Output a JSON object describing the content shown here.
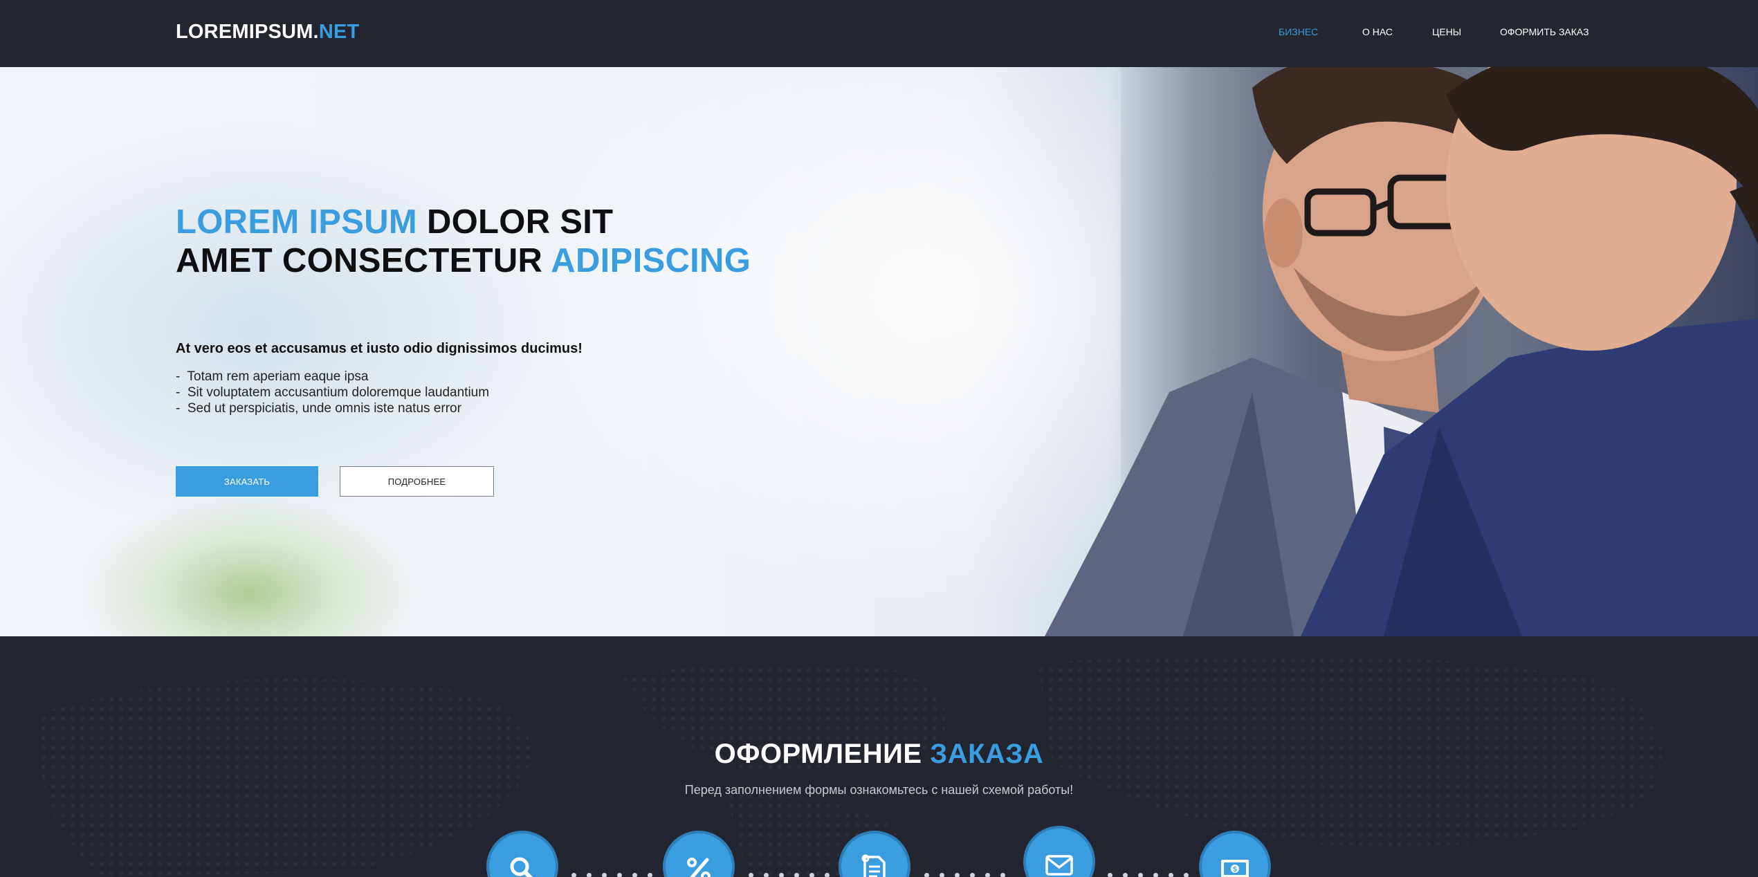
{
  "header": {
    "logo_main": "LOREMIPSUM.",
    "logo_accent": "NET",
    "nav": [
      {
        "label": "БИЗНЕС",
        "active": true
      },
      {
        "label": "О НАС",
        "active": false
      },
      {
        "label": "ЦЕНЫ",
        "active": false
      },
      {
        "label": "ОФОРМИТЬ ЗАКАЗ",
        "active": false
      }
    ]
  },
  "hero": {
    "title": {
      "part1_accent": "LOREM IPSUM",
      "part2": " DOLOR SIT",
      "part3": "AMET CONSECTETUR ",
      "part4_accent": "ADIPISCING"
    },
    "lead": "At vero eos et accusamus et iusto odio dignissimos ducimus!",
    "bullets": [
      "-  Totam rem aperiam eaque ipsa",
      "-  Sit voluptatem accusantium doloremque laudantium",
      "-  Sed ut perspiciatis, unde omnis iste natus error"
    ],
    "btn_primary": "ЗАКАЗАТЬ",
    "btn_secondary": "ПОДРОБНЕЕ"
  },
  "order": {
    "title_main": "ОФОРМЛЕНИЕ ",
    "title_accent": "ЗАКАЗА",
    "subtitle": "Перед заполнением формы ознакомьтесь с нашей схемой работы!",
    "steps": [
      {
        "icon": "search-icon"
      },
      {
        "icon": "percent-icon"
      },
      {
        "icon": "document-icon"
      },
      {
        "icon": "envelope-icon"
      },
      {
        "icon": "money-icon"
      }
    ]
  },
  "colors": {
    "accent": "#3a9de0",
    "dark_bg": "#22242f",
    "header_bg": "#23252f"
  }
}
